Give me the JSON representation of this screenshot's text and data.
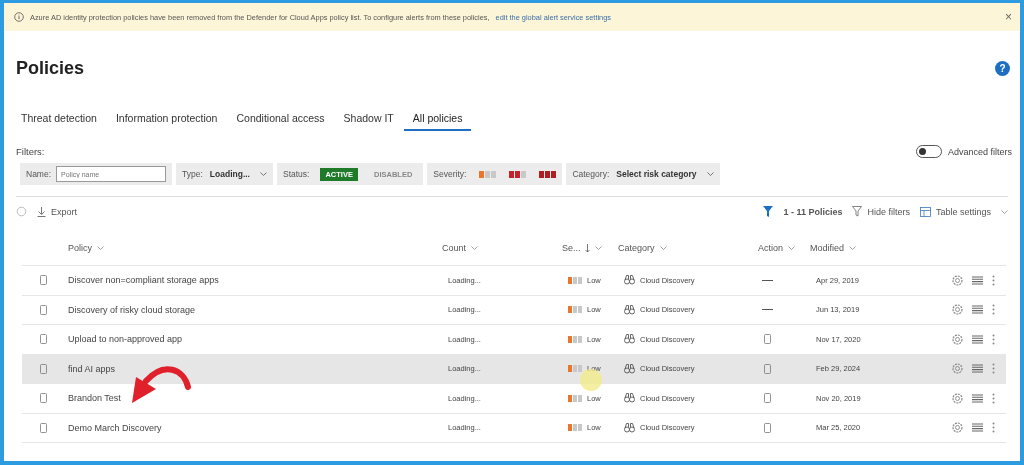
{
  "banner": {
    "text": "Azure AD identity protection policies have been removed from the Defender for Cloud Apps policy list. To configure alerts from these policies,",
    "link": "edit the global alert service settings",
    "close": "×"
  },
  "page": {
    "title": "Policies",
    "help": "?"
  },
  "tabs": [
    {
      "label": "Threat detection",
      "selected": false
    },
    {
      "label": "Information protection",
      "selected": false
    },
    {
      "label": "Conditional access",
      "selected": false
    },
    {
      "label": "Shadow IT",
      "selected": false
    },
    {
      "label": "All policies",
      "selected": true
    }
  ],
  "filters": {
    "label": "Filters:",
    "advanced": {
      "label": "Advanced filters",
      "on": false
    },
    "name": {
      "label": "Name:",
      "placeholder": "Policy name"
    },
    "type": {
      "label": "Type:",
      "value": "Loading..."
    },
    "status": {
      "label": "Status:",
      "options": [
        {
          "label": "ACTIVE",
          "selected": true
        },
        {
          "label": "DISABLED",
          "selected": false
        }
      ]
    },
    "severity": {
      "label": "Severity:",
      "options": [
        {
          "stars": 1,
          "color": "#e8762b"
        },
        {
          "stars": 2,
          "color": "#c8202a"
        },
        {
          "stars": 3,
          "color": "#b01e24"
        }
      ]
    },
    "category": {
      "label": "Category:",
      "value": "Select risk category"
    }
  },
  "toolbar": {
    "export": "Export",
    "count": "1 - 11 Policies",
    "hide_filters": "Hide filters",
    "table_settings": "Table settings"
  },
  "table": {
    "columns": [
      "Policy",
      "Count",
      "Se...",
      "Category",
      "Action",
      "Modified"
    ],
    "rows": [
      {
        "policy": "Discover non=compliant storage apps",
        "count": "Loading...",
        "stars": 1,
        "severity": "Low",
        "category": "Cloud Discovery",
        "kind": "dash",
        "modified": "Apr 29, 2019",
        "highlighted": false
      },
      {
        "policy": "Discovery of risky cloud storage",
        "count": "Loading...",
        "stars": 1,
        "severity": "Low",
        "category": "Cloud Discovery",
        "kind": "dash",
        "modified": "Jun 13, 2019",
        "highlighted": false
      },
      {
        "policy": "Upload to non-approved app",
        "count": "Loading...",
        "stars": 1,
        "severity": "Low",
        "category": "Cloud Discovery",
        "kind": "device",
        "modified": "Nov 17, 2020",
        "highlighted": false
      },
      {
        "policy": "find AI apps",
        "count": "Loading...",
        "stars": 1,
        "severity": "Low",
        "category": "Cloud Discovery",
        "kind": "device",
        "modified": "Feb 29, 2024",
        "highlighted": true
      },
      {
        "policy": "Brandon Test",
        "count": "Loading...",
        "stars": 1,
        "severity": "Low",
        "category": "Cloud Discovery",
        "kind": "device",
        "modified": "Nov 20, 2019",
        "highlighted": false
      },
      {
        "policy": "Demo March Discovery",
        "count": "Loading...",
        "stars": 1,
        "severity": "Low",
        "category": "Cloud Discovery",
        "kind": "device",
        "modified": "Mar 25, 2020",
        "highlighted": false
      }
    ]
  }
}
